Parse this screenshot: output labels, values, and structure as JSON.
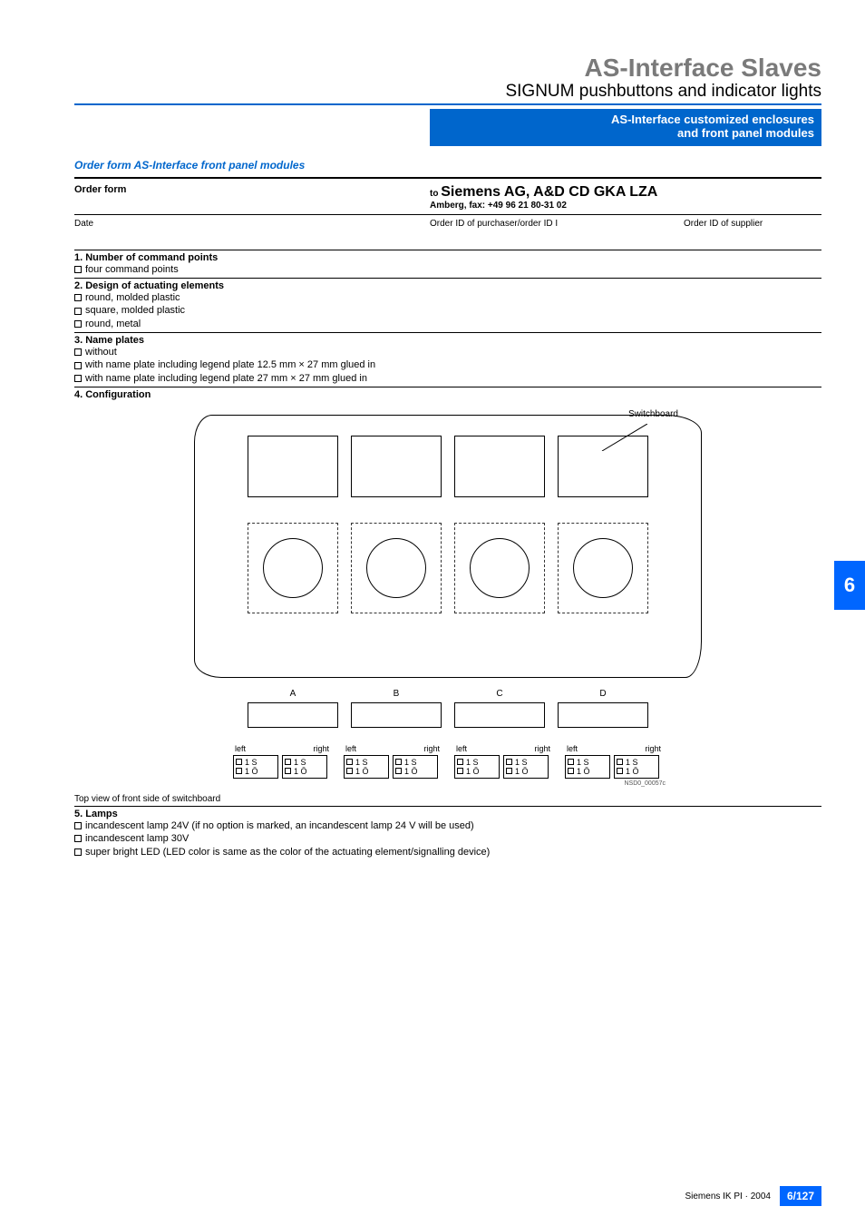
{
  "header": {
    "title1": "AS-Interface Slaves",
    "title2": "SIGNUM pushbuttons and indicator lights",
    "band_line1": "AS-Interface customized enclosures",
    "band_line2": "and front panel modules"
  },
  "section_label": "Order form AS-Interface front panel modules",
  "order_form": {
    "label": "Order form",
    "to_prefix": "to ",
    "to_company": "Siemens AG, A&D CD GKA LZA",
    "fax": "Amberg, fax: +49 96 21 80-31 02",
    "date_label": "Date",
    "order_id_purchaser_label": "Order ID of purchaser/order ID I",
    "order_id_supplier_label": "Order ID of supplier"
  },
  "q1": {
    "heading": "1. Number of command points",
    "opt1": "four command points"
  },
  "q2": {
    "heading": "2. Design of actuating elements",
    "opt1": "round, molded plastic",
    "opt2": "square, molded plastic",
    "opt3": "round, metal"
  },
  "q3": {
    "heading": "3. Name plates",
    "opt1": "without",
    "opt2": "with name plate including legend plate 12.5 mm × 27 mm glued in",
    "opt3": "with name plate including legend plate 27 mm × 27 mm glued in"
  },
  "q4": {
    "heading": "4. Configuration",
    "switchboard_label": "Switchboard",
    "letters": [
      "A",
      "B",
      "C",
      "D"
    ],
    "left": "left",
    "right": "right",
    "contact_s": "1 S",
    "contact_o": "1 Ö",
    "img_code": "NSD0_00057c",
    "caption": "Top view of front side of switchboard"
  },
  "q5": {
    "heading": "5. Lamps",
    "opt1": "incandescent lamp 24V (if no option is marked, an incandescent lamp 24 V will be used)",
    "opt2": "incandescent lamp 30V",
    "opt3": "super bright LED (LED color is same as the color of the actuating element/signalling device)"
  },
  "side_tab": "6",
  "footer": {
    "text": "Siemens IK PI · 2004",
    "page": "6/127"
  }
}
